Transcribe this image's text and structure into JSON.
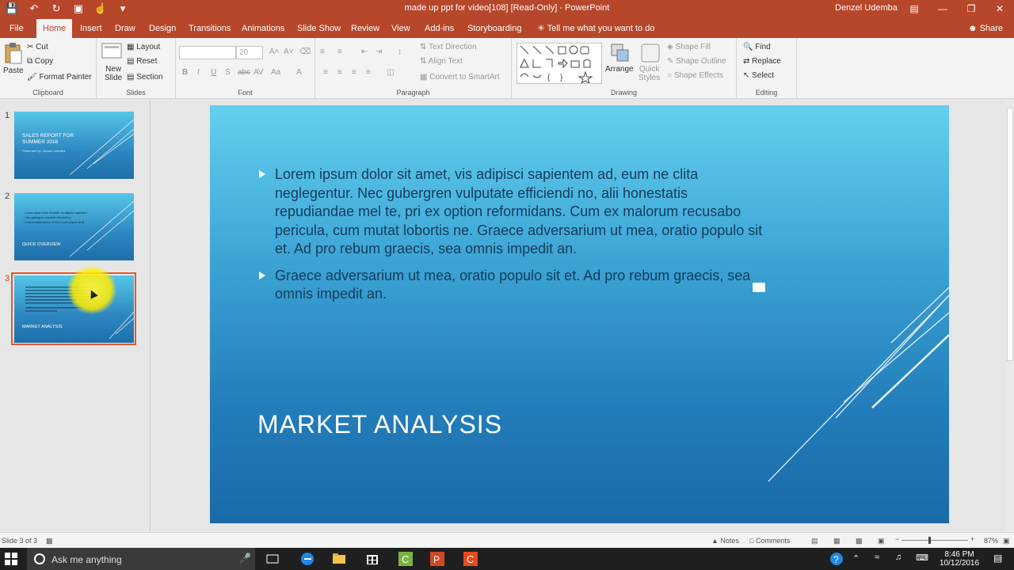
{
  "window": {
    "title": "made up ppt for video[108] [Read-Only] - PowerPoint",
    "user": "Denzel Udemba"
  },
  "qat": {
    "icons": [
      "save-icon",
      "undo-icon",
      "redo-icon",
      "present-icon",
      "touch-icon",
      "customize-icon"
    ]
  },
  "tabs": [
    {
      "label": "File"
    },
    {
      "label": "Home"
    },
    {
      "label": "Insert"
    },
    {
      "label": "Draw"
    },
    {
      "label": "Design"
    },
    {
      "label": "Transitions"
    },
    {
      "label": "Animations"
    },
    {
      "label": "Slide Show"
    },
    {
      "label": "Review"
    },
    {
      "label": "View"
    },
    {
      "label": "Add-ins"
    },
    {
      "label": "Storyboarding"
    },
    {
      "label": "Tell me what you want to do"
    }
  ],
  "share_label": "Share",
  "ribbon": {
    "clipboard": {
      "paste": "Paste",
      "cut": "Cut",
      "copy": "Copy",
      "format_painter": "Format Painter",
      "label": "Clipboard"
    },
    "slides": {
      "new_slide_1": "New",
      "new_slide_2": "Slide",
      "layout": "Layout",
      "reset": "Reset",
      "section": "Section",
      "label": "Slides"
    },
    "font": {
      "font_size": "20",
      "label": "Font",
      "bold": "B",
      "italic": "I",
      "underline": "U",
      "strike": "S",
      "abc": "abc"
    },
    "paragraph": {
      "text_direction": "Text Direction",
      "align_text": "Align Text",
      "convert_smartart": "Convert to SmartArt",
      "label": "Paragraph"
    },
    "drawing": {
      "arrange": "Arrange",
      "quick_styles_1": "Quick",
      "quick_styles_2": "Styles",
      "shape_fill": "Shape Fill",
      "shape_outline": "Shape Outline",
      "shape_effects": "Shape Effects",
      "label": "Drawing"
    },
    "editing": {
      "find": "Find",
      "replace": "Replace",
      "select": "Select",
      "label": "Editing"
    }
  },
  "thumbnails": [
    {
      "number": "1",
      "title": "SALES REPORT FOR SUMMER 2016",
      "subtitle": "Presented by: Denzel Udemba"
    },
    {
      "number": "2",
      "title": "QUICK OVERVIEW",
      "lines": [
        "• Lorem ipsum dolor sit amet, vis adipisci sapientem",
        "• Nec gubergren vulputate efficiendi no",
        "• Graece adversarium ut mea, oratio populo sit et"
      ]
    },
    {
      "number": "3",
      "title": "MARKET ANALYSIS",
      "selected": true
    }
  ],
  "slide": {
    "bullets": [
      "Lorem ipsum dolor sit amet, vis adipisci sapientem ad, eum ne clita neglegentur. Nec gubergren vulputate efficiendi no, alii honestatis repudiandae mel te, pri ex option reformidans. Cum ex malorum recusabo pericula, cum mutat lobortis ne. Graece adversarium ut mea, oratio populo sit et. Ad pro rebum graecis, sea omnis impedit an.",
      "Graece adversarium ut mea, oratio populo sit et. Ad pro rebum graecis, sea omnis impedit an."
    ],
    "title": "MARKET ANALYSIS"
  },
  "status": {
    "slide_info": "Slide 3 of 3",
    "notes": "Notes",
    "comments": "Comments",
    "zoom": "87%"
  },
  "taskbar": {
    "search_placeholder": "Ask me anything",
    "time": "8:46 PM",
    "date": "10/12/2016"
  },
  "colors": {
    "accent": "#b7472a",
    "selected_border": "#e2582f"
  }
}
